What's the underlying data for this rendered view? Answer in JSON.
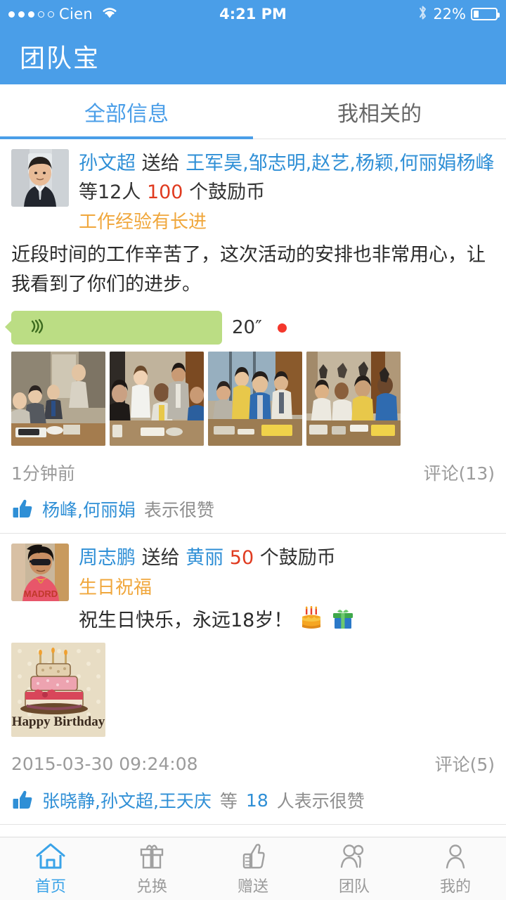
{
  "status_bar": {
    "signal_dots_filled": 3,
    "signal_dots_total": 5,
    "carrier": "Cien",
    "wifi_icon": "wifi-icon",
    "time": "4:21 PM",
    "bluetooth_icon": "bluetooth-icon",
    "battery_percent": "22%",
    "battery_fill_ratio": 0.22
  },
  "app_bar": {
    "title": "团队宝",
    "background": "#4a9ee8"
  },
  "tabs": [
    {
      "label": "全部信息",
      "active": true
    },
    {
      "label": "我相关的",
      "active": false
    }
  ],
  "colors": {
    "accent": "#4a9ee8",
    "link": "#2f8fd6",
    "amount": "#e03b20",
    "subject": "#f0a73c",
    "voice_bubble": "#bbdd84",
    "unread_dot": "#f4372c",
    "muted": "#9b9b9b"
  },
  "posts": [
    {
      "avatar_name": "avatar-sun-wenchao",
      "sender": "孙文超",
      "verb": "送给",
      "receivers": "王军昊,邹志明,赵艺,杨颖,何丽娟杨峰",
      "others": "等12人",
      "amount": "100",
      "unit": "个鼓励币",
      "subject": "工作经验有长进",
      "content": "近段时间的工作辛苦了，这次活动的安排也非常用心，让我看到了你们的进步。",
      "voice": {
        "duration": "20″",
        "unread": true
      },
      "photos": [
        "office-meeting-photo-1",
        "office-meeting-photo-2",
        "office-meeting-photo-3",
        "office-celebration-photo-4"
      ],
      "timestamp": "1分钟前",
      "comments_label": "评论(13)",
      "like_names": "杨峰,何丽娟",
      "like_suffix": "表示很赞"
    },
    {
      "avatar_name": "avatar-zhou-zhipeng",
      "sender": "周志鹏",
      "verb": "送给",
      "receivers": "黄丽",
      "others": "",
      "amount": "50",
      "unit": "个鼓励币",
      "subject": "生日祝福",
      "content": "祝生日快乐，永远18岁！",
      "emoji": [
        "birthday-cake-emoji",
        "gift-box-emoji"
      ],
      "card_image": "happy-birthday-card",
      "card_text": "Happy Birthday",
      "timestamp": "2015-03-30 09:24:08",
      "comments_label": "评论(5)",
      "like_names": "张晓静,孙文超,王天庆",
      "like_mid": "等",
      "like_count": "18",
      "like_suffix": "人表示很赞"
    }
  ],
  "bottom_nav": [
    {
      "label": "首页",
      "icon": "home-icon",
      "active": true
    },
    {
      "label": "兑换",
      "icon": "gift-icon",
      "active": false
    },
    {
      "label": "赠送",
      "icon": "thumbs-up-icon",
      "active": false
    },
    {
      "label": "团队",
      "icon": "people-icon",
      "active": false
    },
    {
      "label": "我的",
      "icon": "person-icon",
      "active": false
    }
  ]
}
